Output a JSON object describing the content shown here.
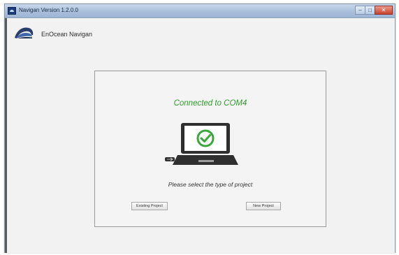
{
  "window": {
    "title": "Navigan Version 1.2.0.0",
    "minimize_glyph": "–",
    "maximize_glyph": "□",
    "close_glyph": "✕"
  },
  "header": {
    "logo_icon": "enocean-logo-icon",
    "brand_name": "EnOcean Navigan"
  },
  "main": {
    "status": "Connected to COM4",
    "status_color": "#2e9e2e",
    "illustration_icon": "laptop-connected-icon",
    "prompt": "Please select the type of project",
    "existing_project_label": "Existing Project",
    "new_project_label": "New Project"
  }
}
